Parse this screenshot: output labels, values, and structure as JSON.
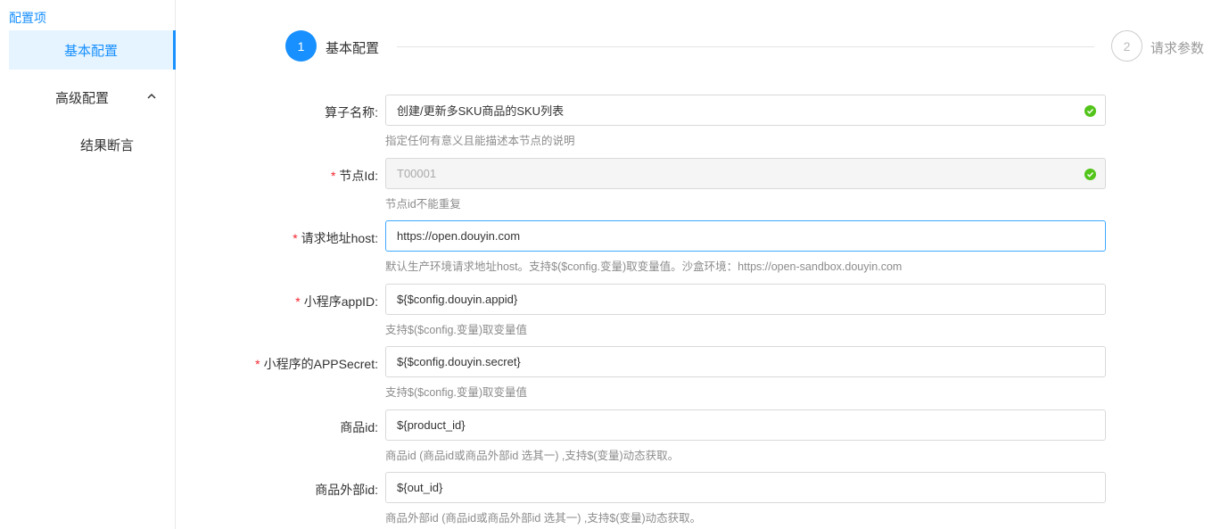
{
  "sidebar": {
    "title": "配置项",
    "items": [
      {
        "label": "基本配置"
      },
      {
        "label": "高级配置"
      },
      {
        "label": "结果断言"
      }
    ]
  },
  "steps": [
    {
      "number": "1",
      "label": "基本配置"
    },
    {
      "number": "2",
      "label": "请求参数"
    }
  ],
  "form": {
    "fields": [
      {
        "label": "算子名称:",
        "required": false,
        "value": "创建/更新多SKU商品的SKU列表",
        "help": "指定任何有意义且能描述本节点的说明"
      },
      {
        "label": "节点Id:",
        "required": true,
        "value": "T00001",
        "help": "节点id不能重复"
      },
      {
        "label": "请求地址host:",
        "required": true,
        "value": "https://open.douyin.com",
        "help": "默认生产环境请求地址host。支持$($config.变量)取变量值。沙盒环境：https://open-sandbox.douyin.com"
      },
      {
        "label": "小程序appID:",
        "required": true,
        "value": "${$config.douyin.appid}",
        "help": "支持$($config.变量)取变量值"
      },
      {
        "label": "小程序的APPSecret:",
        "required": true,
        "value": "${$config.douyin.secret}",
        "help": "支持$($config.变量)取变量值"
      },
      {
        "label": "商品id:",
        "required": false,
        "value": "${product_id}",
        "help": "商品id (商品id或商品外部id 选其一) ,支持$(变量)动态获取。"
      },
      {
        "label": "商品外部id:",
        "required": false,
        "value": "${out_id}",
        "help": "商品外部id (商品id或商品外部id 选其一) ,支持$(变量)动态获取。"
      }
    ]
  },
  "colors": {
    "accent": "#1890ff",
    "success": "#52c41a",
    "required": "#f5222d"
  }
}
